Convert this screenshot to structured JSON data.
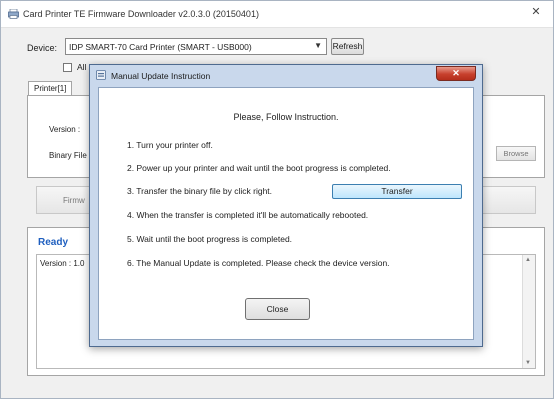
{
  "window": {
    "title": "Card Printer TE Firmware Downloader v2.0.3.0 (20150401)",
    "close_glyph": "✕"
  },
  "device": {
    "label": "Device:",
    "selected": "IDP SMART-70 Card Printer (SMART - USB000)",
    "dropdown_glyph": "▼",
    "refresh_label": "Refresh"
  },
  "auto_option": {
    "label": "All",
    "checked": false
  },
  "tabs": [
    {
      "label": "Printer[1]",
      "selected": true
    }
  ],
  "printer_panel": {
    "version_label": "Version :",
    "binary_label": "Binary File",
    "browse_label": "Browse",
    "update_label": "Firmw"
  },
  "log": {
    "status": "Ready",
    "status_color": "#1f5fbf",
    "text": "Version : 1.0"
  },
  "dialog": {
    "title": "Manual Update Instruction",
    "close_glyph": "✕",
    "heading": "Please, Follow Instruction.",
    "steps": [
      "1. Turn your printer off.",
      "2. Power up your printer and wait until the boot progress is completed.",
      "3. Transfer the binary file by click right.",
      "4. When the transfer is completed it'll be automatically rebooted.",
      "5. Wait until the boot progress is completed.",
      "6. The Manual Update is completed. Please check the device version."
    ],
    "transfer_label": "Transfer",
    "close_label": "Close"
  },
  "icons": {
    "app_icon": "printer-icon",
    "dialog_icon": "app-icon"
  },
  "colors": {
    "dialog_frame": "#c9d8ec",
    "close_button_red": "#c7402d",
    "transfer_highlight": "#bee6fd"
  }
}
